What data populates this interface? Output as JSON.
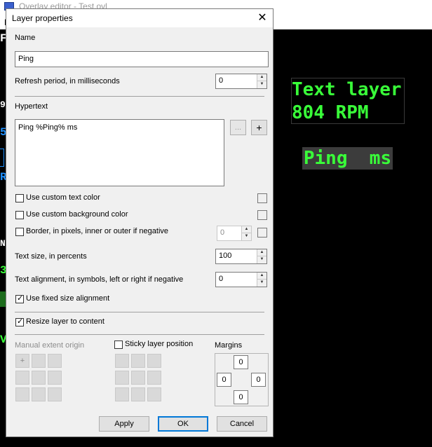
{
  "background_app": {
    "title": "Overlay editor - Test.ovl",
    "menu_fragment": "L",
    "left_strip": [
      "FI",
      "90",
      "5",
      "R",
      "NV",
      "3",
      "V"
    ],
    "canvas": {
      "text_layer_lines": [
        "Text layer",
        "804 RPM"
      ],
      "ping_layer_text": "Ping  ms",
      "text_color": "#39ff39"
    }
  },
  "dialog": {
    "title": "Layer properties",
    "close_icon": "close-icon",
    "name": {
      "label": "Name",
      "value": "Ping"
    },
    "refresh": {
      "label": "Refresh period, in milliseconds",
      "value": "0"
    },
    "hypertext": {
      "label": "Hypertext",
      "value": "Ping %Ping% ms",
      "browse_label": "...",
      "add_label": "+"
    },
    "custom_text_color": {
      "label": "Use custom text color",
      "checked": false
    },
    "custom_bg_color": {
      "label": "Use custom background color",
      "checked": false
    },
    "border": {
      "label": "Border, in pixels, inner or outer if negative",
      "checked": false,
      "value": "0"
    },
    "text_size": {
      "label": "Text size, in percents",
      "value": "100"
    },
    "text_alignment": {
      "label": "Text alignment, in symbols, left or right if negative",
      "value": "0"
    },
    "fixed_size": {
      "label": "Use fixed size alignment",
      "checked": true
    },
    "resize": {
      "label": "Resize layer to content",
      "checked": true
    },
    "extent_origin": {
      "label": "Manual extent origin",
      "marker": "+"
    },
    "sticky": {
      "label": "Sticky layer position",
      "checked": false
    },
    "margins": {
      "label": "Margins",
      "top": "0",
      "left": "0",
      "right": "0",
      "bottom": "0"
    },
    "buttons": {
      "apply": "Apply",
      "ok": "OK",
      "cancel": "Cancel"
    }
  }
}
